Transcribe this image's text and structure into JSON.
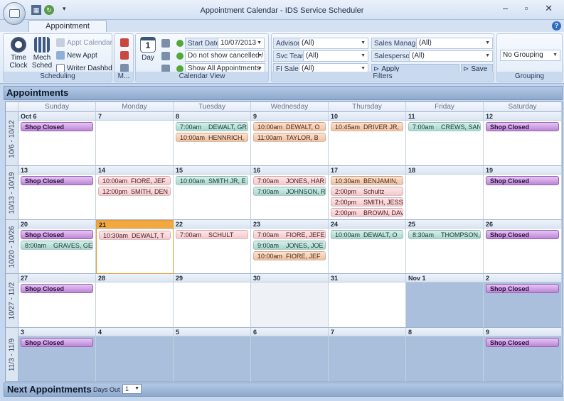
{
  "window": {
    "title": "Appointment Calendar - IDS Service Scheduler",
    "controls": "– ▫ ✕"
  },
  "quick_access": {
    "customize": "▾"
  },
  "ribbon_tab": "Appointment Calendar",
  "help": "?",
  "groups": {
    "scheduling": {
      "caption": "Scheduling",
      "time_clock": "Time\nClock",
      "mech_sched": "Mech\nSched",
      "appt_calendar": "Appt Calendar",
      "new_appt": "New Appt",
      "writer_dashbd": "Writer Dashbd"
    },
    "m": {
      "caption": "M..."
    },
    "calendar_view": {
      "caption": "Calendar View",
      "day": "Day",
      "day_icon_num": "1",
      "start_date_label": "Start Date",
      "start_date_value": "10/07/2013",
      "cancelled_value": "Do not show cancelled /",
      "show_value": "Show All Appointments"
    },
    "filters": {
      "caption": "Filters",
      "advisor_label": "Advisor",
      "advisor_value": "(All)",
      "svc_team_label": "Svc Team",
      "svc_team_value": "(All)",
      "fi_sales_label": "FI Sales",
      "fi_sales_value": "(All)",
      "sales_manager_label": "Sales Manager",
      "sales_manager_value": "(All)",
      "salesperson_label": "Salesperson",
      "salesperson_value": "(All)",
      "apply": "Apply",
      "save": "Save"
    },
    "grouping": {
      "caption": "Grouping",
      "value": "No Grouping"
    }
  },
  "appointments_title": "Appointments",
  "days_of_week": [
    "Sunday",
    "Monday",
    "Tuesday",
    "Wednesday",
    "Thursday",
    "Friday",
    "Saturday"
  ],
  "weeks": [
    {
      "label": "10/6 - 10/12",
      "days": [
        {
          "num": "Oct 6",
          "appts": [
            {
              "kind": "shop",
              "text": "Shop Closed"
            }
          ]
        },
        {
          "num": "7",
          "appts": []
        },
        {
          "num": "8",
          "appts": [
            {
              "kind": "teal",
              "time": "7:00am",
              "name": "DEWALT, GR"
            },
            {
              "kind": "peach",
              "time": "10:00am",
              "name": "HENNRICH,"
            }
          ]
        },
        {
          "num": "9",
          "appts": [
            {
              "kind": "peach",
              "time": "10:00am",
              "name": "DEWALT, O"
            },
            {
              "kind": "peach",
              "time": "11:00am",
              "name": "TAYLOR, B"
            }
          ]
        },
        {
          "num": "10",
          "appts": [
            {
              "kind": "peach",
              "time": "10:45am",
              "name": "DRIVER JR,"
            }
          ]
        },
        {
          "num": "11",
          "appts": [
            {
              "kind": "teal",
              "time": "7:00am",
              "name": "CREWS, SAN"
            }
          ]
        },
        {
          "num": "12",
          "appts": [
            {
              "kind": "shop",
              "text": "Shop Closed"
            }
          ]
        }
      ]
    },
    {
      "label": "10/13 - 10/19",
      "days": [
        {
          "num": "13",
          "appts": [
            {
              "kind": "shop",
              "text": "Shop Closed"
            }
          ]
        },
        {
          "num": "14",
          "appts": [
            {
              "kind": "pink",
              "time": "10:00am",
              "name": "FIORE, JEF"
            },
            {
              "kind": "pink",
              "time": "12:00pm",
              "name": "SMITH, DEN"
            }
          ]
        },
        {
          "num": "15",
          "appts": [
            {
              "kind": "teal",
              "time": "10:00am",
              "name": "SMITH JR, E"
            }
          ]
        },
        {
          "num": "16",
          "appts": [
            {
              "kind": "pink",
              "time": "7:00am",
              "name": "JONES, HAR"
            },
            {
              "kind": "teal",
              "time": "7:00am",
              "name": "JOHNSON, RI"
            }
          ]
        },
        {
          "num": "17",
          "appts": [
            {
              "kind": "peach",
              "time": "10:30am",
              "name": "BENJAMIN,"
            },
            {
              "kind": "pink",
              "time": "2:00pm",
              "name": "Schultz"
            },
            {
              "kind": "pink",
              "time": "2:00pm",
              "name": "SMITH, JESS"
            },
            {
              "kind": "pink",
              "time": "2:00pm",
              "name": "BROWN, DAV"
            }
          ]
        },
        {
          "num": "18",
          "appts": []
        },
        {
          "num": "19",
          "appts": [
            {
              "kind": "shop",
              "text": "Shop Closed"
            }
          ]
        }
      ]
    },
    {
      "label": "10/20 - 10/26",
      "days": [
        {
          "num": "20",
          "appts": [
            {
              "kind": "shop",
              "text": "Shop Closed"
            },
            {
              "kind": "teal",
              "time": "8:00am",
              "name": "GRAVES, GE"
            }
          ]
        },
        {
          "num": "21",
          "today": true,
          "appts": [
            {
              "kind": "pink",
              "time": "10:30am",
              "name": "DEWALT, T"
            }
          ]
        },
        {
          "num": "22",
          "appts": [
            {
              "kind": "pink",
              "time": "7:00am",
              "name": "SCHULT"
            }
          ]
        },
        {
          "num": "23",
          "appts": [
            {
              "kind": "pink",
              "time": "7:00am",
              "name": "FIORE, JEFE"
            },
            {
              "kind": "teal",
              "time": "9:00am",
              "name": "JONES, JOE"
            },
            {
              "kind": "peach",
              "time": "10:00am",
              "name": "FIORE, JEF"
            }
          ]
        },
        {
          "num": "24",
          "appts": [
            {
              "kind": "teal",
              "time": "10:00am",
              "name": "DEWALT, O"
            }
          ]
        },
        {
          "num": "25",
          "appts": [
            {
              "kind": "teal",
              "time": "8:30am",
              "name": "THOMPSON,"
            }
          ]
        },
        {
          "num": "26",
          "appts": [
            {
              "kind": "shop",
              "text": "Shop Closed"
            }
          ]
        }
      ]
    },
    {
      "label": "10/27 - 11/2",
      "days": [
        {
          "num": "27",
          "appts": [
            {
              "kind": "shop",
              "text": "Shop Closed"
            }
          ]
        },
        {
          "num": "28",
          "appts": []
        },
        {
          "num": "29",
          "appts": []
        },
        {
          "num": "30",
          "dotted": true,
          "appts": []
        },
        {
          "num": "31",
          "appts": []
        },
        {
          "num": "Nov 1",
          "other": true,
          "appts": []
        },
        {
          "num": "2",
          "other": true,
          "appts": [
            {
              "kind": "shop",
              "text": "Shop Closed"
            }
          ]
        }
      ]
    },
    {
      "label": "11/3 - 11/9",
      "days": [
        {
          "num": "3",
          "other": true,
          "appts": [
            {
              "kind": "shop",
              "text": "Shop Closed"
            }
          ]
        },
        {
          "num": "4",
          "other": true,
          "appts": []
        },
        {
          "num": "5",
          "other": true,
          "appts": []
        },
        {
          "num": "6",
          "other": true,
          "appts": []
        },
        {
          "num": "7",
          "other": true,
          "appts": []
        },
        {
          "num": "8",
          "other": true,
          "appts": []
        },
        {
          "num": "9",
          "other": true,
          "appts": [
            {
              "kind": "shop",
              "text": "Shop Closed"
            }
          ]
        }
      ]
    }
  ],
  "next_appointments": {
    "title": "Next Appointments",
    "days_out_label": "Days Out",
    "days_out_value": "1"
  },
  "colors": {
    "shop": "#bb86d6",
    "teal": "#a7d7ce",
    "peach": "#f0c09f",
    "pink": "#f5c8cc",
    "today": "#f2a840",
    "other_month": "#a9bfdb"
  }
}
